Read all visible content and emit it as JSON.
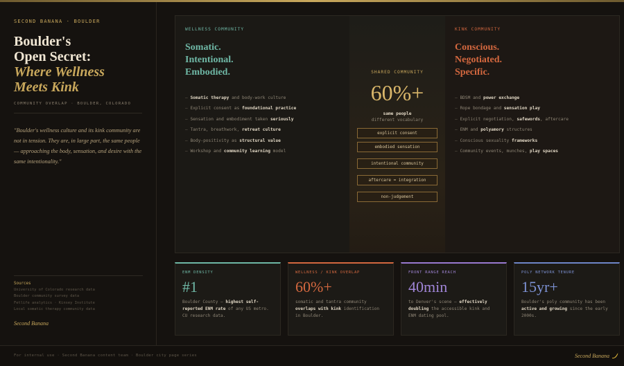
{
  "sidebar": {
    "eyebrow": "SECOND BANANA · BOULDER",
    "title_lines": [
      "Boulder's",
      "Open Secret:"
    ],
    "title_italic_lines": [
      "Where Wellness",
      "Meets Kink"
    ],
    "subtitle": "COMMUNITY OVERLAP · BOULDER, COLORADO",
    "quote": "\"Boulder's wellness culture and its kink community are not in tension. They are, in large part, the same people — approaching the body, sensation, and desire with the same intentionality.\"",
    "sources_heading": "Sources",
    "sources": [
      "University of Colorado research data",
      "Boulder community survey data",
      "Fetlife analytics · Kinsey Institute",
      "Local somatic therapy community data"
    ],
    "brand": "Second Banana"
  },
  "wellness": {
    "label": "WELLNESS COMMUNITY",
    "heading": [
      "Somatic.",
      "Intentional.",
      "Embodied."
    ],
    "bullets": [
      {
        "pre": "",
        "bold": "Somatic therapy",
        "post": " and body-work culture"
      },
      {
        "pre": "Explicit consent as ",
        "bold": "foundational practice",
        "post": ""
      },
      {
        "pre": "Sensation and embodiment taken ",
        "bold": "seriously",
        "post": ""
      },
      {
        "pre": "Tantra, breathwork, ",
        "bold": "retreat culture",
        "post": ""
      },
      {
        "pre": "Body-positivity as ",
        "bold": "structural value",
        "post": ""
      },
      {
        "pre": "Workshop and ",
        "bold": "community learning",
        "post": " model"
      }
    ]
  },
  "shared": {
    "label": "SHARED COMMUNITY",
    "big": "60%+",
    "sub1": "same people",
    "sub2": "different vocabulary",
    "tags": [
      "explicit consent",
      "embodied sensation",
      "intentional community",
      "aftercare = integration",
      "non-judgement"
    ]
  },
  "kink": {
    "label": "KINK COMMUNITY",
    "heading": [
      "Conscious.",
      "Negotiated.",
      "Specific."
    ],
    "bullets": [
      {
        "pre": "BDSM and ",
        "bold": "power exchange",
        "post": ""
      },
      {
        "pre": "Rope bondage and ",
        "bold": "sensation play",
        "post": ""
      },
      {
        "pre": "Explicit negotiation, ",
        "bold": "safewords",
        "post": ", aftercare"
      },
      {
        "pre": "ENM and ",
        "bold": "polyamory",
        "post": " structures"
      },
      {
        "pre": "Conscious sexuality ",
        "bold": "frameworks",
        "post": ""
      },
      {
        "pre": "Community events, munches, ",
        "bold": "play spaces",
        "post": ""
      }
    ]
  },
  "cards": [
    {
      "label": "ENM DENSITY",
      "big": "#1",
      "text_pre": "Boulder County — ",
      "text_bold": "highest self-reported ENM rate",
      "text_post": " of any US metro. CU research data.",
      "color": "#6fb8a6"
    },
    {
      "label": "WELLNESS / KINK OVERLAP",
      "big": "60%+",
      "text_pre": "somatic and tantra community ",
      "text_bold": "overlaps with kink",
      "text_post": " identification in Boulder.",
      "color": "#d4683f"
    },
    {
      "label": "FRONT RANGE REACH",
      "big": "40min",
      "text_pre": "to Denver's scene — ",
      "text_bold": "effectively doubling",
      "text_post": " the accessible kink and ENM dating pool.",
      "color": "#9a7ad1"
    },
    {
      "label": "POLY NETWORK TENURE",
      "big": "15yr+",
      "text_pre": "Boulder's poly community has been ",
      "text_bold": "active and growing",
      "text_post": " since the early 2000s.",
      "color": "#6f86c9"
    }
  ],
  "footer": {
    "text": "For internal use · Second Banana content team · Boulder city page series",
    "brand": "Second Banana"
  }
}
